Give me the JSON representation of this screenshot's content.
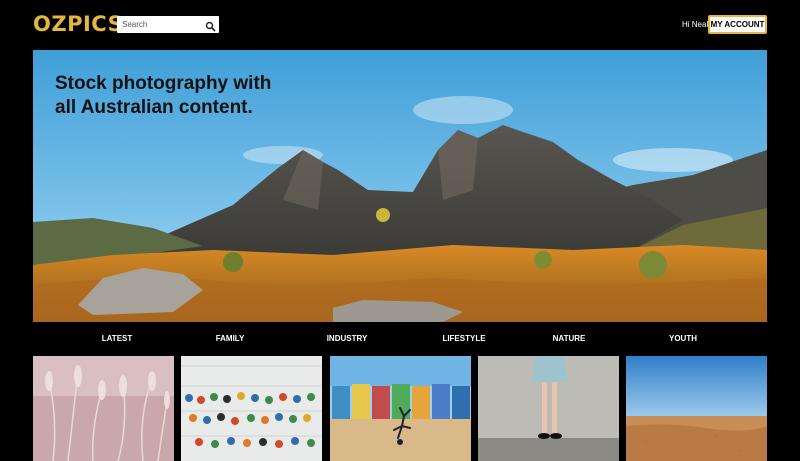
{
  "header": {
    "logo": "OZPICS",
    "search_placeholder": "Search",
    "greeting": "Hi Neal",
    "account_label": "MY ACCOUNT"
  },
  "hero": {
    "line1": "Stock photography with",
    "line2": "all Australian content."
  },
  "categories": [
    "LATEST",
    "FAMILY",
    "INDUSTRY",
    "LIFESTYLE",
    "NATURE",
    "YOUTH"
  ],
  "colors": {
    "brand": "#e4b73f",
    "background": "#000000"
  }
}
